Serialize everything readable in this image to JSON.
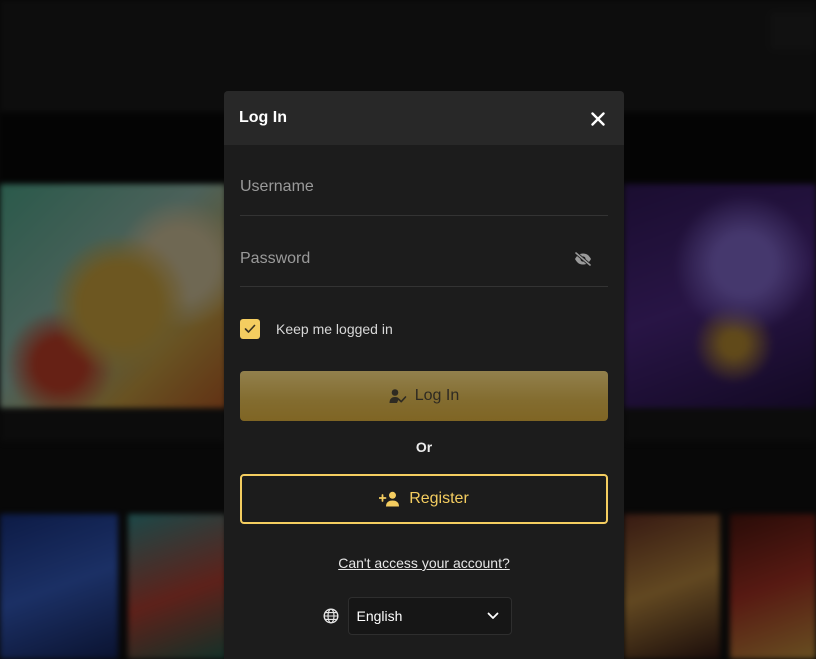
{
  "modal": {
    "title": "Log In",
    "close_icon": "close-icon"
  },
  "form": {
    "username_placeholder": "Username",
    "username_value": "",
    "password_placeholder": "Password",
    "password_value": "",
    "password_toggle_icon": "eye-off-icon",
    "keep_logged_in_label": "Keep me logged in",
    "keep_logged_in_checked": true
  },
  "actions": {
    "login_label": "Log In",
    "login_icon": "user-check-icon",
    "or_label": "Or",
    "register_label": "Register",
    "register_icon": "user-plus-icon",
    "forgot_label": "Can't access your account?"
  },
  "language": {
    "icon": "globe-icon",
    "selected": "English"
  },
  "colors": {
    "accent": "#f4cd60",
    "modal_bg": "#1c1c1c",
    "header_bg": "#282828",
    "login_button": "#836c2f"
  }
}
